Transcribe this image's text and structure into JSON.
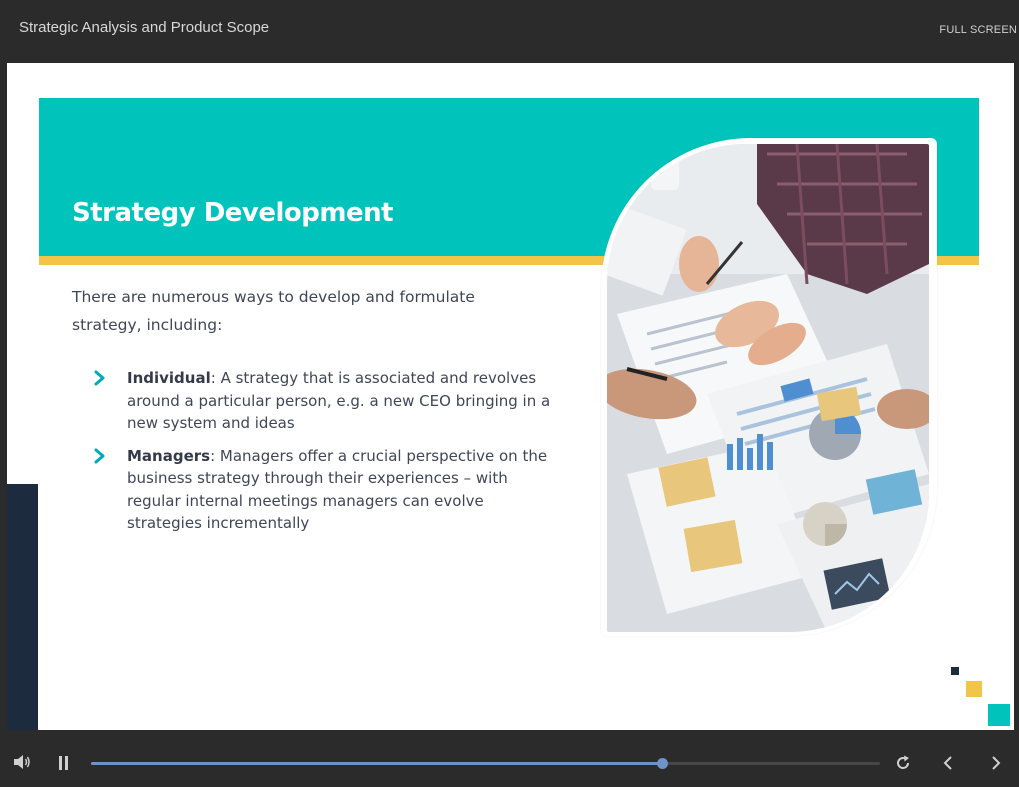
{
  "header": {
    "title": "Strategic Analysis and Product Scope",
    "fullscreen_label": "FULL SCREEN"
  },
  "slide": {
    "heading": "Strategy Development",
    "intro": "There are numerous ways to develop and formulate strategy, including:",
    "bullets": [
      {
        "term": "Individual",
        "text": ": A strategy that is associated and revolves around a particular person, e.g. a new CEO bringing in a new system and ideas"
      },
      {
        "term": "Managers",
        "text": ": Managers offer a crucial perspective on the business strategy through their experiences – with regular internal meetings managers can evolve strategies incrementally"
      }
    ]
  },
  "player": {
    "progress": 0.724,
    "icons": [
      "volume-icon",
      "pause-icon",
      "replay-icon",
      "previous-icon",
      "next-icon"
    ]
  },
  "colors": {
    "accent_teal": "#00c4bb",
    "accent_gold": "#f2c447",
    "navy": "#1c2b3d",
    "progress_blue": "#6d93c9",
    "chrome_dark": "#2b2b2b"
  }
}
